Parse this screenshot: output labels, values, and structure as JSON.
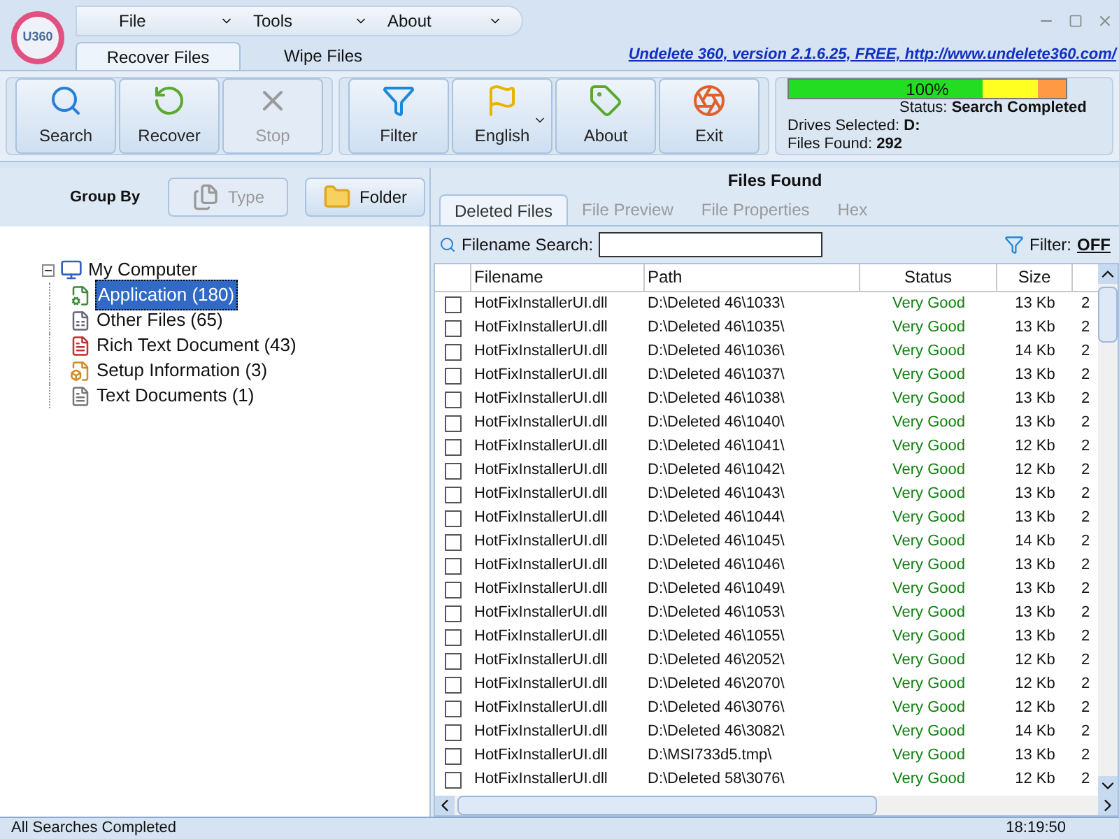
{
  "app": {
    "logo_text": "U360",
    "about_link": "Undelete 360, version 2.1.6.25, FREE, http://www.undelete360.com/"
  },
  "menu": [
    {
      "label": "File"
    },
    {
      "label": "Tools"
    },
    {
      "label": "About"
    }
  ],
  "ribbon_tabs": [
    {
      "label": "Recover Files",
      "selected": true
    },
    {
      "label": "Wipe Files",
      "selected": false
    }
  ],
  "toolbar": [
    {
      "kind": "search",
      "label": "Search",
      "disabled": false
    },
    {
      "kind": "recover",
      "label": "Recover",
      "disabled": false
    },
    {
      "kind": "stop",
      "label": "Stop",
      "disabled": true
    },
    {
      "kind": "filter",
      "label": "Filter",
      "disabled": false
    },
    {
      "kind": "language",
      "label": "English",
      "disabled": false
    },
    {
      "kind": "about",
      "label": "About",
      "disabled": false
    },
    {
      "kind": "exit",
      "label": "Exit",
      "disabled": false
    }
  ],
  "progress": {
    "level": 1.0,
    "reading": "100%"
  },
  "status_info": {
    "status_label": "Status:",
    "status_value": "Search Completed",
    "drives_label": "Drives Selected:",
    "drives_value": "D:",
    "files_label": "Files Found:",
    "files_value": "292"
  },
  "group_by": {
    "label": "Group By",
    "buttons": [
      {
        "kind": "type",
        "label": "Type",
        "disabled": true
      },
      {
        "kind": "folder",
        "label": "Folder",
        "disabled": false
      }
    ]
  },
  "tree": {
    "label": "My Computer",
    "expanded": true,
    "children": [
      {
        "kind": "application",
        "label": "Application (180)",
        "selected": true
      },
      {
        "kind": "other",
        "label": "Other Files (65)",
        "selected": false
      },
      {
        "kind": "rich",
        "label": "Rich Text Document (43)",
        "selected": false
      },
      {
        "kind": "setup",
        "label": "Setup Information (3)",
        "selected": false
      },
      {
        "kind": "text",
        "label": "Text Documents (1)",
        "selected": false
      }
    ]
  },
  "files_panel": {
    "title": "Files Found",
    "tabs": [
      {
        "label": "Deleted Files",
        "selected": true
      },
      {
        "label": "File Preview",
        "selected": false
      },
      {
        "label": "File Properties",
        "selected": false
      },
      {
        "label": "Hex",
        "selected": false
      }
    ],
    "search": {
      "label": "Filename Search:"
    },
    "filter": {
      "label": "Filter:",
      "value": "OFF"
    }
  },
  "table": {
    "columns": [
      "Filename",
      "Path",
      "Status",
      "Size"
    ],
    "rows": [
      {
        "checked": false,
        "filename": "HotFixInstallerUI.dll",
        "path": "D:\\Deleted 46\\1033\\",
        "status": "Very Good",
        "size": "13 Kb",
        "column_6": "2"
      },
      {
        "checked": false,
        "filename": "HotFixInstallerUI.dll",
        "path": "D:\\Deleted 46\\1035\\",
        "status": "Very Good",
        "size": "13 Kb",
        "column_6": "2"
      },
      {
        "checked": false,
        "filename": "HotFixInstallerUI.dll",
        "path": "D:\\Deleted 46\\1036\\",
        "status": "Very Good",
        "size": "14 Kb",
        "column_6": "2"
      },
      {
        "checked": false,
        "filename": "HotFixInstallerUI.dll",
        "path": "D:\\Deleted 46\\1037\\",
        "status": "Very Good",
        "size": "13 Kb",
        "column_6": "2"
      },
      {
        "checked": false,
        "filename": "HotFixInstallerUI.dll",
        "path": "D:\\Deleted 46\\1038\\",
        "status": "Very Good",
        "size": "13 Kb",
        "column_6": "2"
      },
      {
        "checked": false,
        "filename": "HotFixInstallerUI.dll",
        "path": "D:\\Deleted 46\\1040\\",
        "status": "Very Good",
        "size": "13 Kb",
        "column_6": "2"
      },
      {
        "checked": false,
        "filename": "HotFixInstallerUI.dll",
        "path": "D:\\Deleted 46\\1041\\",
        "status": "Very Good",
        "size": "12 Kb",
        "column_6": "2"
      },
      {
        "checked": false,
        "filename": "HotFixInstallerUI.dll",
        "path": "D:\\Deleted 46\\1042\\",
        "status": "Very Good",
        "size": "12 Kb",
        "column_6": "2"
      },
      {
        "checked": false,
        "filename": "HotFixInstallerUI.dll",
        "path": "D:\\Deleted 46\\1043\\",
        "status": "Very Good",
        "size": "13 Kb",
        "column_6": "2"
      },
      {
        "checked": false,
        "filename": "HotFixInstallerUI.dll",
        "path": "D:\\Deleted 46\\1044\\",
        "status": "Very Good",
        "size": "13 Kb",
        "column_6": "2"
      },
      {
        "checked": false,
        "filename": "HotFixInstallerUI.dll",
        "path": "D:\\Deleted 46\\1045\\",
        "status": "Very Good",
        "size": "14 Kb",
        "column_6": "2"
      },
      {
        "checked": false,
        "filename": "HotFixInstallerUI.dll",
        "path": "D:\\Deleted 46\\1046\\",
        "status": "Very Good",
        "size": "13 Kb",
        "column_6": "2"
      },
      {
        "checked": false,
        "filename": "HotFixInstallerUI.dll",
        "path": "D:\\Deleted 46\\1049\\",
        "status": "Very Good",
        "size": "13 Kb",
        "column_6": "2"
      },
      {
        "checked": false,
        "filename": "HotFixInstallerUI.dll",
        "path": "D:\\Deleted 46\\1053\\",
        "status": "Very Good",
        "size": "13 Kb",
        "column_6": "2"
      },
      {
        "checked": false,
        "filename": "HotFixInstallerUI.dll",
        "path": "D:\\Deleted 46\\1055\\",
        "status": "Very Good",
        "size": "13 Kb",
        "column_6": "2"
      },
      {
        "checked": false,
        "filename": "HotFixInstallerUI.dll",
        "path": "D:\\Deleted 46\\2052\\",
        "status": "Very Good",
        "size": "12 Kb",
        "column_6": "2"
      },
      {
        "checked": false,
        "filename": "HotFixInstallerUI.dll",
        "path": "D:\\Deleted 46\\2070\\",
        "status": "Very Good",
        "size": "12 Kb",
        "column_6": "2"
      },
      {
        "checked": false,
        "filename": "HotFixInstallerUI.dll",
        "path": "D:\\Deleted 46\\3076\\",
        "status": "Very Good",
        "size": "12 Kb",
        "column_6": "2"
      },
      {
        "checked": false,
        "filename": "HotFixInstallerUI.dll",
        "path": "D:\\Deleted 46\\3082\\",
        "status": "Very Good",
        "size": "14 Kb",
        "column_6": "2"
      },
      {
        "checked": false,
        "filename": "HotFixInstallerUI.dll",
        "path": "D:\\MSI733d5.tmp\\",
        "status": "Very Good",
        "size": "13 Kb",
        "column_6": "2"
      },
      {
        "checked": false,
        "filename": "HotFixInstallerUI.dll",
        "path": "D:\\Deleted 58\\3076\\",
        "status": "Very Good",
        "size": "12 Kb",
        "column_6": "2"
      }
    ]
  },
  "status_bar": {
    "message": "All Searches Completed",
    "time": "18:19:50"
  }
}
